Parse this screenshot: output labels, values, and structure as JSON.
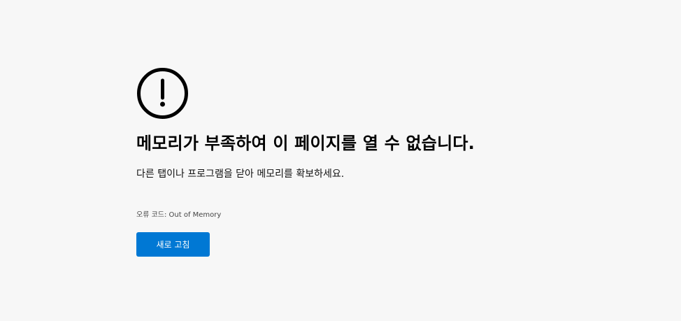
{
  "error_page": {
    "icon": "exclamation-circle-icon",
    "title": "메모리가 부족하여 이 페이지를 열 수 없습니다.",
    "subtitle": "다른 탭이나 프로그램을 닫아 메모리를 확보하세요.",
    "error_code": "오류 코드: Out of Memory",
    "refresh_label": "새로 고침"
  },
  "colors": {
    "background": "#f7f7f7",
    "button": "#0078d4",
    "button_text": "#ffffff",
    "icon": "#000000"
  }
}
